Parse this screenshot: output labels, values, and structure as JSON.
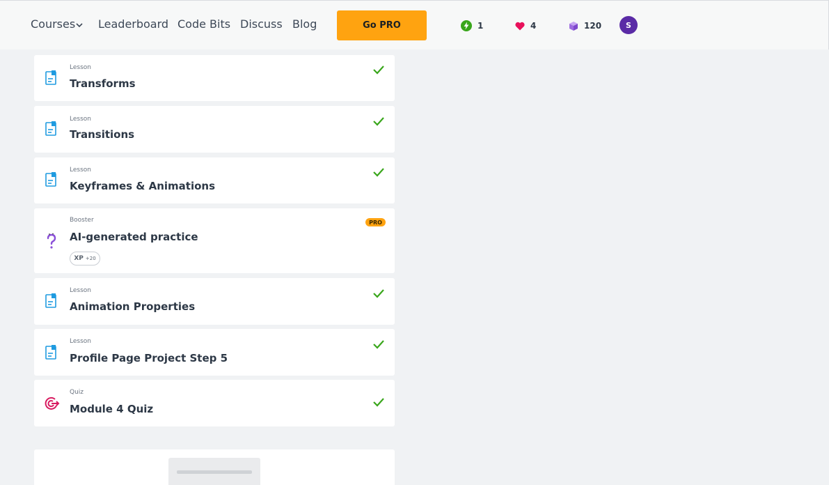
{
  "nav": {
    "courses": "Courses",
    "leaderboard": "Leaderboard",
    "code_bits": "Code Bits",
    "discuss": "Discuss",
    "blog": "Blog",
    "go_pro": "Go PRO"
  },
  "stats": {
    "streak": "1",
    "hearts": "4",
    "bits": "120",
    "avatar_initial": "S"
  },
  "colors": {
    "accent": "#ffa310",
    "check": "#39a61b",
    "lesson_icon": "#1f9be0",
    "booster_icon": "#8a4fd8",
    "quiz_icon": "#d81b60",
    "avatar": "#5a2ba6"
  },
  "items": [
    {
      "kind": "Lesson",
      "title": "Transforms",
      "icon": "document-icon",
      "completed": true
    },
    {
      "kind": "Lesson",
      "title": "Transitions",
      "icon": "document-icon",
      "completed": true
    },
    {
      "kind": "Lesson",
      "title": "Keyframes & Animations",
      "icon": "document-icon",
      "completed": true
    },
    {
      "kind": "Booster",
      "title": "AI-generated practice",
      "icon": "question-icon",
      "badge": "PRO",
      "xp_label": "XP",
      "xp_amount": "+20"
    },
    {
      "kind": "Lesson",
      "title": "Animation Properties",
      "icon": "document-icon",
      "completed": true
    },
    {
      "kind": "Lesson",
      "title": "Profile Page Project Step 5",
      "icon": "document-icon",
      "completed": true
    },
    {
      "kind": "Quiz",
      "title": "Module 4 Quiz",
      "icon": "target-icon",
      "completed": true
    }
  ]
}
